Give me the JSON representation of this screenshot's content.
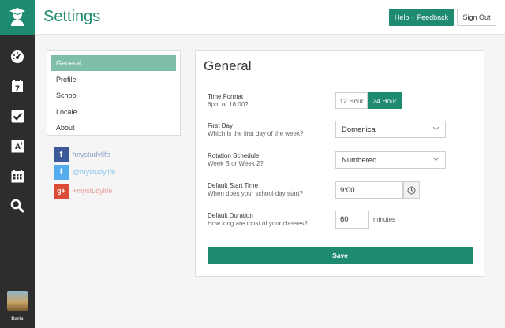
{
  "app": {
    "title": "Settings"
  },
  "header": {
    "help_label": "Help + Feedback",
    "signout_label": "Sign Out"
  },
  "rail": {
    "username": "Dario"
  },
  "nav": {
    "items": [
      "General",
      "Profile",
      "School",
      "Locale",
      "About"
    ],
    "active": "General"
  },
  "social": [
    {
      "icon": "facebook-icon",
      "glyph": "f",
      "text": "/mystudylife",
      "color": "#3b5998"
    },
    {
      "icon": "twitter-icon",
      "glyph": "t",
      "text": "@mystudylife",
      "color": "#55acee"
    },
    {
      "icon": "google-plus-icon",
      "glyph": "g+",
      "text": "+mystudylife",
      "color": "#dd4b39"
    }
  ],
  "panel": {
    "title": "General",
    "time_format": {
      "label": "Time Format",
      "sub": "6pm or 18:00?",
      "options": [
        "12 Hour",
        "24 Hour"
      ],
      "selected": "24 Hour"
    },
    "first_day": {
      "label": "First Day",
      "sub": "Which is the first day of the week?",
      "value": "Domenica"
    },
    "rotation": {
      "label": "Rotation Schedule",
      "sub": "Week B or Week 2?",
      "value": "Numbered"
    },
    "start_time": {
      "label": "Default Start Time",
      "sub": "When does your school day start?",
      "value": "9:00"
    },
    "duration": {
      "label": "Default Duration",
      "sub": "How long are most of your classes?",
      "value": "60",
      "unit": "minutes"
    },
    "save_label": "Save"
  },
  "colors": {
    "accent": "#1e8a70",
    "nav_active": "#7fbfa9",
    "rail": "#2d2d2d"
  }
}
